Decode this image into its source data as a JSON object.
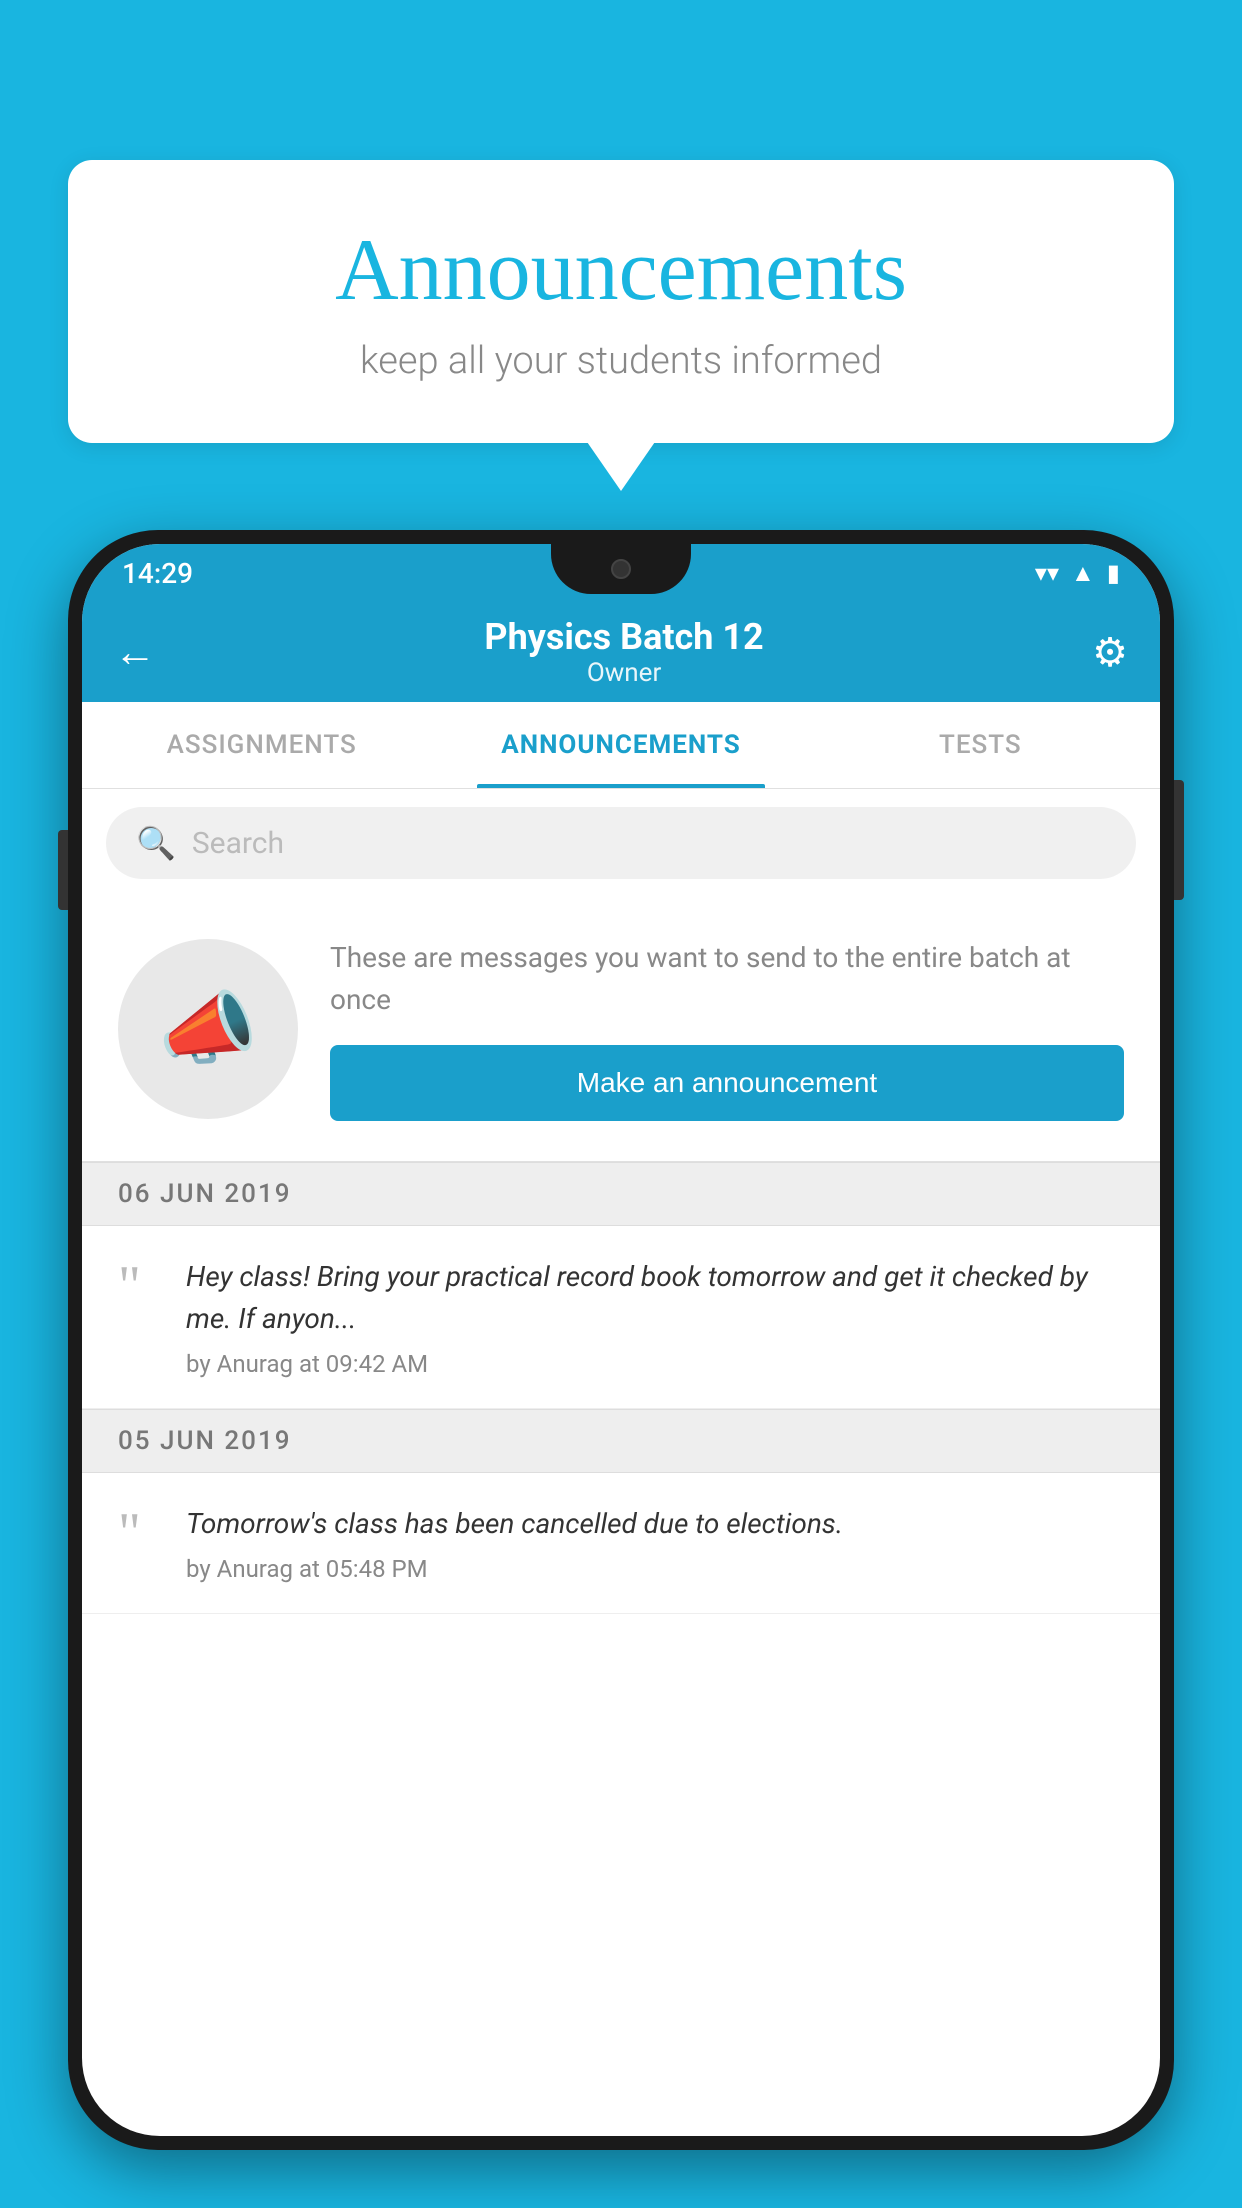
{
  "background_color": "#19b5e0",
  "speech_bubble": {
    "title": "Announcements",
    "subtitle": "keep all your students informed"
  },
  "phone": {
    "status_bar": {
      "time": "14:29",
      "icons": [
        "wifi",
        "signal",
        "battery"
      ]
    },
    "app_bar": {
      "back_label": "←",
      "title": "Physics Batch 12",
      "subtitle": "Owner",
      "settings_label": "⚙"
    },
    "tabs": [
      {
        "label": "ASSIGNMENTS",
        "active": false
      },
      {
        "label": "ANNOUNCEMENTS",
        "active": true
      },
      {
        "label": "TESTS",
        "active": false
      }
    ],
    "search": {
      "placeholder": "Search"
    },
    "prompt_card": {
      "text": "These are messages you want to send to the entire batch at once",
      "button_label": "Make an announcement"
    },
    "announcements": [
      {
        "date": "06  JUN  2019",
        "items": [
          {
            "text": "Hey class! Bring your practical record book tomorrow and get it checked by me. If anyon...",
            "meta": "by Anurag at 09:42 AM"
          }
        ]
      },
      {
        "date": "05  JUN  2019",
        "items": [
          {
            "text": "Tomorrow's class has been cancelled due to elections.",
            "meta": "by Anurag at 05:48 PM"
          }
        ]
      }
    ]
  }
}
